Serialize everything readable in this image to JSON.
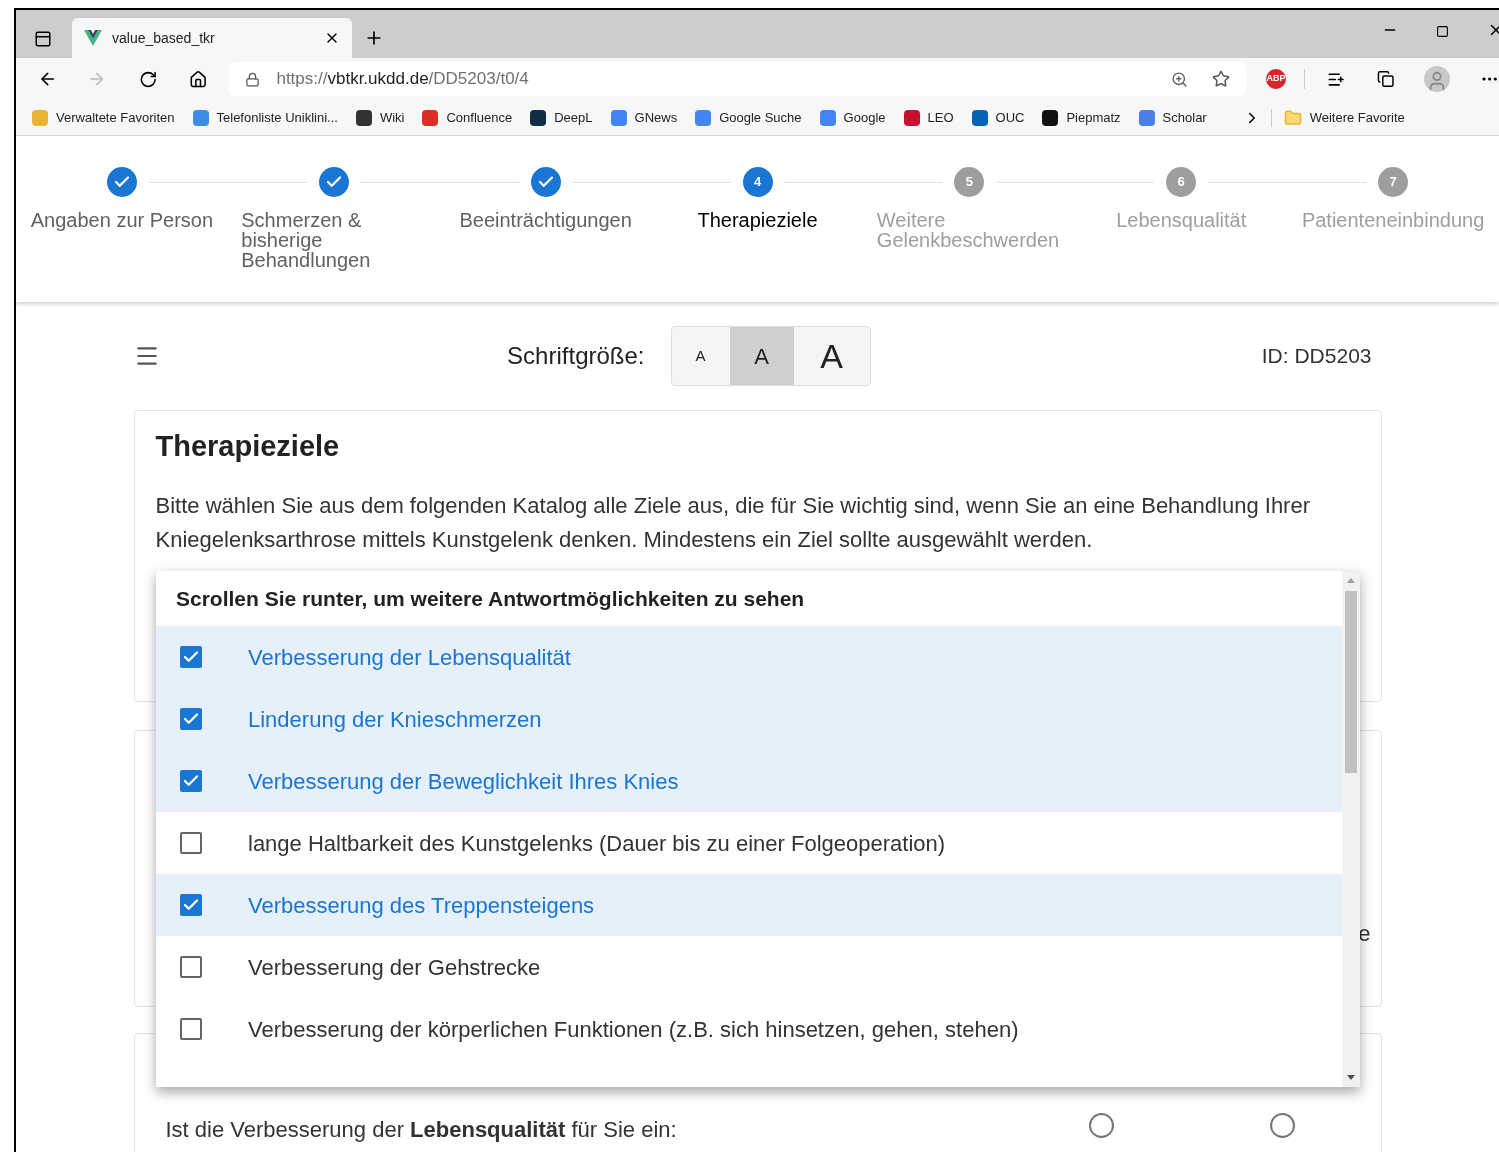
{
  "browser": {
    "tab": {
      "title": "value_based_tkr"
    },
    "address": {
      "scheme": "https://",
      "host": "vbtkr.ukdd.de",
      "path": "/DD5203/t0/4"
    },
    "adblock_badge": "ABP",
    "bookmarks": [
      {
        "label": "Verwaltete Favoriten",
        "color": "#e8b436"
      },
      {
        "label": "Telefonliste Uniklini...",
        "color": "#3a8ee6"
      },
      {
        "label": "Wiki",
        "color": "#333333"
      },
      {
        "label": "Confluence",
        "color": "#d93025"
      },
      {
        "label": "DeepL",
        "color": "#0f2b46"
      },
      {
        "label": "GNews",
        "color": "#4285f4"
      },
      {
        "label": "Google Suche",
        "color": "#4285f4"
      },
      {
        "label": "Google",
        "color": "#4285f4"
      },
      {
        "label": "LEO",
        "color": "#c8102e"
      },
      {
        "label": "OUC",
        "color": "#0364b8"
      },
      {
        "label": "Piepmatz",
        "color": "#111111"
      },
      {
        "label": "Scholar",
        "color": "#4a7ee8"
      }
    ],
    "other_favorites": "Weitere Favorite"
  },
  "stepper": {
    "steps": [
      {
        "label": "Angaben zur Person",
        "completed": true,
        "selected": false
      },
      {
        "label": "Schmerzen & bisherige Behandlungen",
        "completed": true,
        "selected": false
      },
      {
        "label": "Beeinträchtigungen",
        "completed": true,
        "selected": false
      },
      {
        "label": "Therapieziele",
        "completed": false,
        "selected": true,
        "number": "4"
      },
      {
        "label": "Weitere Gelenkbeschwerden",
        "completed": false,
        "selected": false,
        "number": "5"
      },
      {
        "label": "Lebensqualität",
        "completed": false,
        "selected": false,
        "number": "6"
      },
      {
        "label": "Patienteneinbindung",
        "completed": false,
        "selected": false,
        "number": "7"
      }
    ]
  },
  "toolbar": {
    "font_size_label": "Schriftgröße:",
    "font_sizes": [
      {
        "label": "A",
        "selected": false
      },
      {
        "label": "A",
        "selected": true
      },
      {
        "label": "A",
        "selected": false
      }
    ],
    "id_label": "ID: DD5203"
  },
  "goals_card": {
    "title": "Therapieziele",
    "description": "Bitte wählen Sie aus dem folgenden Katalog alle Ziele aus, die für Sie wichtig sind, wenn Sie an eine Behandlung Ihrer Kniegelenksarthrose mittels Kunstgelenk denken. Mindestens ein Ziel sollte ausgewählt werden."
  },
  "goals_dropdown": {
    "hint": "Scrollen Sie runter, um weitere Antwortmöglichkeiten zu sehen",
    "options": [
      {
        "label": "Verbesserung der Lebensqualität",
        "checked": true
      },
      {
        "label": "Linderung der Knieschmerzen",
        "checked": true
      },
      {
        "label": "Verbesserung der Beweglichkeit Ihres Knies",
        "checked": true
      },
      {
        "label": "lange Haltbarkeit des Kunstgelenks (Dauer bis zu einer Folgeoperation)",
        "checked": false
      },
      {
        "label": "Verbesserung des Treppensteigens",
        "checked": true
      },
      {
        "label": "Verbesserung der Gehstrecke",
        "checked": false
      },
      {
        "label": "Verbesserung der körperlichen Funktionen (z.B. sich hinsetzen, gehen, stehen)",
        "checked": false
      }
    ]
  },
  "second_card": {
    "text_fragment": "e"
  },
  "question_card": {
    "question": "Ist die Verbesserung der **Lebensqualität** für Sie ein:",
    "options": [
      {
        "selected": false
      },
      {
        "selected": false
      }
    ]
  }
}
